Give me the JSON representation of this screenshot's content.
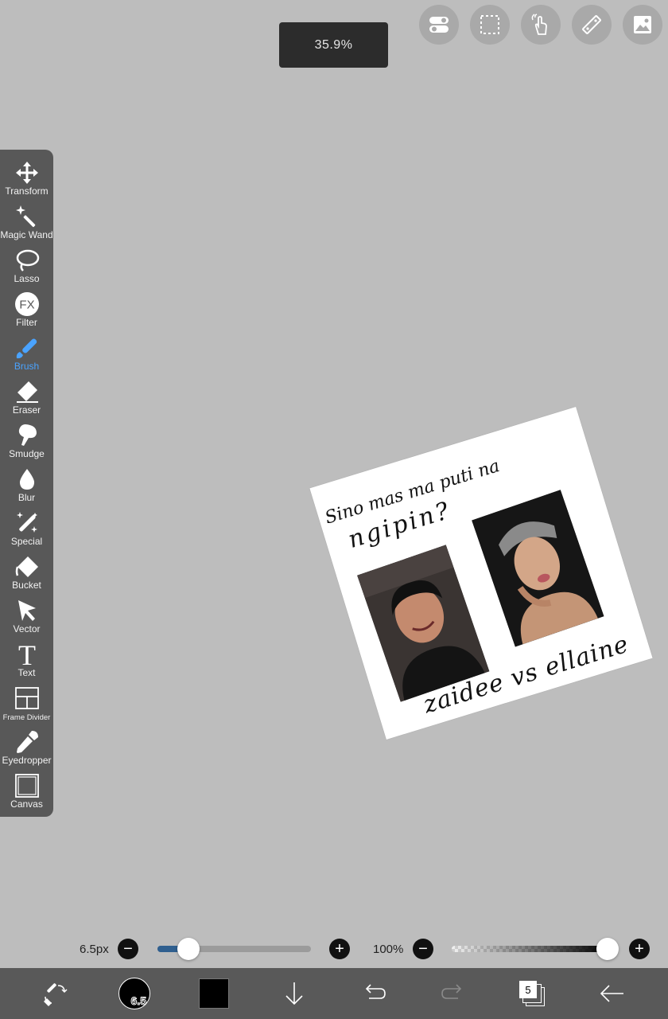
{
  "zoom": {
    "value": "35.9%"
  },
  "top_buttons": [
    "toggle-settings-icon",
    "selection-icon",
    "hand-gesture-icon",
    "ruler-icon",
    "image-icon"
  ],
  "tools": [
    {
      "label": "Transform",
      "icon": "move-arrows-icon"
    },
    {
      "label": "Magic Wand",
      "icon": "magic-wand-icon"
    },
    {
      "label": "Lasso",
      "icon": "lasso-icon"
    },
    {
      "label": "Filter",
      "icon": "fx-icon",
      "icon_text": "FX"
    },
    {
      "label": "Brush",
      "icon": "brush-icon",
      "active": true
    },
    {
      "label": "Eraser",
      "icon": "eraser-icon"
    },
    {
      "label": "Smudge",
      "icon": "smudge-icon"
    },
    {
      "label": "Blur",
      "icon": "drop-icon"
    },
    {
      "label": "Special",
      "icon": "sparkle-icon"
    },
    {
      "label": "Bucket",
      "icon": "bucket-icon"
    },
    {
      "label": "Vector",
      "icon": "cursor-arrow-icon"
    },
    {
      "label": "Text",
      "icon": "text-icon",
      "icon_text": "T"
    },
    {
      "label": "Frame Divider",
      "icon": "frame-divider-icon"
    },
    {
      "label": "Eyedropper",
      "icon": "eyedropper-icon"
    },
    {
      "label": "Canvas",
      "icon": "canvas-icon"
    }
  ],
  "artwork": {
    "line1": "Sino mas ma puti na",
    "line2": "ngipin?",
    "caption": "zaidee vs ellaine"
  },
  "brush_size": {
    "label": "6.5px",
    "level": 0.13
  },
  "opacity": {
    "label": "100%",
    "level": 1.0
  },
  "bottom_bar": {
    "brush_size_badge": "6.5",
    "layer_count": "5",
    "primary_color": "#000000"
  },
  "colors": {
    "accent": "#4aa3ff",
    "slider_fill": "#2f5f8f"
  }
}
